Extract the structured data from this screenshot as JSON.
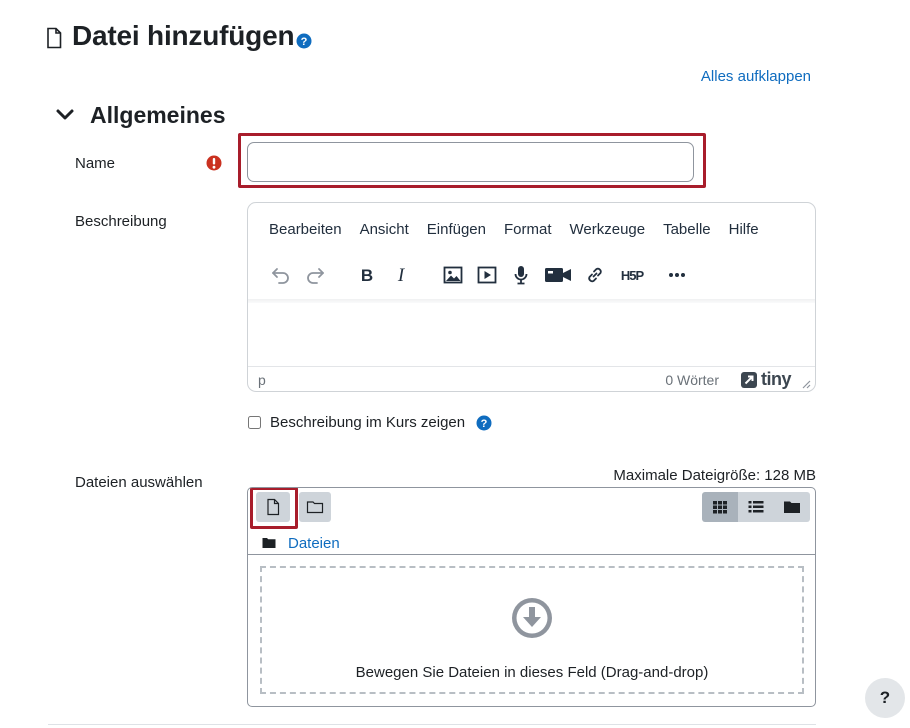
{
  "header": {
    "title": "Datei hinzufügen",
    "expand_all": "Alles aufklappen"
  },
  "section": {
    "title": "Allgemeines"
  },
  "name_field": {
    "label": "Name",
    "value": "",
    "required_icon": "exclamation-circle-icon"
  },
  "description": {
    "label": "Beschreibung",
    "menu": [
      "Bearbeiten",
      "Ansicht",
      "Einfügen",
      "Format",
      "Werkzeuge",
      "Tabelle",
      "Hilfe"
    ],
    "toolbar_icons": [
      "undo-icon",
      "redo-icon",
      "bold-icon",
      "italic-icon",
      "image-icon",
      "media-icon",
      "microphone-icon",
      "video-camera-icon",
      "link-icon",
      "h5p-icon",
      "more-icon"
    ],
    "status_path": "p",
    "word_count": "0 Wörter",
    "tiny_brand": "tiny"
  },
  "show_description": {
    "label": "Beschreibung im Kurs zeigen",
    "checked": false
  },
  "files": {
    "label": "Dateien auswählen",
    "max_size": "Maximale Dateigröße: 128 MB",
    "path_link": "Dateien",
    "dropzone_text": "Bewegen Sie Dateien in dieses Feld (Drag-and-drop)"
  },
  "help_fab": {
    "label": "?"
  },
  "colors": {
    "accent": "#0f6cbf",
    "highlight": "#a81d2b",
    "required": "#ca3120",
    "help_icon": "#0f6cbf"
  }
}
